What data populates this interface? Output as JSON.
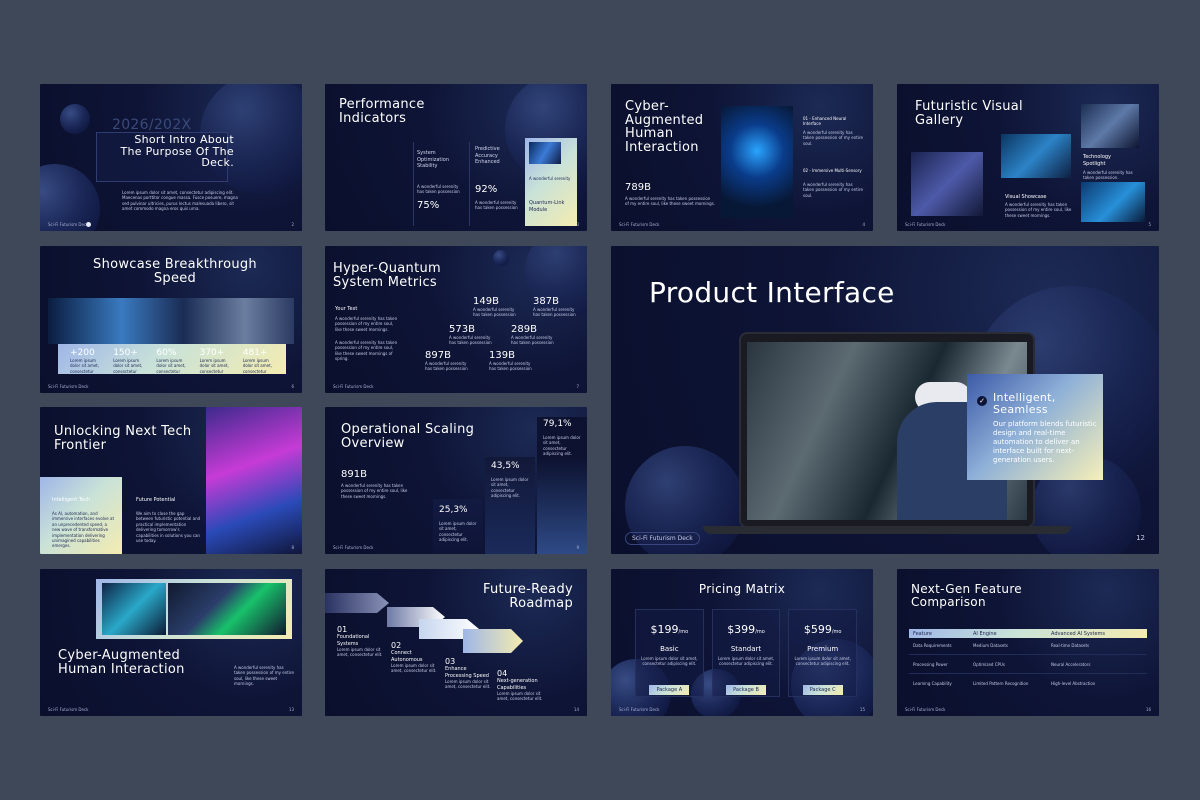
{
  "deck_name": "Sci-Fi Futurism Deck",
  "s1": {
    "year": "2026/202X",
    "title": "Short Intro About The Purpose Of The Deck.",
    "body": "Lorem ipsum dolor sit amet, consectetur adipiscing elit. Maecenas porttitor congue massa. Fusce posuere, magna sed pulvinar ultricies, purus lectus malesuada libero, sit amet commodo magna eros quis urna.",
    "num": "2"
  },
  "s2": {
    "title": "Performance Indicators",
    "c1_label": "System Optimization Stability",
    "c1_desc": "A wonderful serenity has taken possession",
    "c1_val": "75%",
    "c2_label": "Predictive Accuracy Enhanced",
    "c2_desc": "A wonderful serenity has taken possession",
    "c2_val": "92%",
    "c3_desc": "A wonderful serenity",
    "c3_label": "Quantum-Link Module",
    "num": "3"
  },
  "s3": {
    "title": "Cyber-Augmented Human Interaction",
    "stat": "789B",
    "stat_desc": "A wonderful serenity has taken possession of my entire soul, like these sweet mornings.",
    "i1": "01 - Enhanced Neural Interface",
    "i1_desc": "A wonderful serenity has taken possession of my entire soul.",
    "i2": "02 - Immersive Multi-Sensory",
    "i2_desc": "A wonderful serenity has taken possession of my entire soul.",
    "num": "4"
  },
  "s4": {
    "title": "Futuristic Visual Gallery",
    "cap1": "Visual Showcase",
    "cap1_desc": "A wonderful serenity has taken possession of my entire soul, like these sweet mornings.",
    "cap2": "Technology Spotlight",
    "cap2_desc": "A wonderful serenity has taken possession.",
    "num": "5"
  },
  "s5": {
    "title": "Showcase Breakthrough Speed",
    "stats": [
      {
        "v": "+200",
        "d": "Lorem ipsum dolor sit amet, consectetur"
      },
      {
        "v": "150+",
        "d": "Lorem ipsum dolor sit amet, consectetur"
      },
      {
        "v": "60%",
        "d": "Lorem ipsum dolor sit amet, consectetur"
      },
      {
        "v": "370+",
        "d": "Lorem ipsum dolor sit amet, consectetur"
      },
      {
        "v": "481+",
        "d": "Lorem ipsum dolor sit amet, consectetur"
      }
    ],
    "num": "6"
  },
  "s6": {
    "title": "Hyper-Quantum System Metrics",
    "sub": "Your Text",
    "p1": "A wonderful serenity has taken possession of my entire soul, like these sweet mornings.",
    "p2": "A wonderful serenity has taken possession of my entire soul, like these sweet mornings of spring.",
    "m": [
      {
        "v": "149B",
        "d": "A wonderful serenity has taken possession"
      },
      {
        "v": "387B",
        "d": "A wonderful serenity has taken possession"
      },
      {
        "v": "573B",
        "d": "A wonderful serenity has taken possession"
      },
      {
        "v": "289B",
        "d": "A wonderful serenity has taken possession"
      },
      {
        "v": "897B",
        "d": "A wonderful serenity has taken possession"
      },
      {
        "v": "139B",
        "d": "A wonderful serenity has taken possession"
      }
    ],
    "num": "7"
  },
  "s7": {
    "title": "Product Interface",
    "card_title": "Intelligent, Seamless",
    "card_body": "Our platform blends futuristic design and real-time automation to deliver an interface built for next-generation users.",
    "num": "12"
  },
  "s8": {
    "title": "Unlocking Next Tech Frontier",
    "c1": "Intelligent Tech",
    "c1_desc": "As AI, automation, and immersive interfaces evolve at an unprecedented speed, a new wave of transformative implementation delivering unimagined capabilities emerges.",
    "c2": "Future Potential",
    "c2_desc": "We aim to close the gap between futuristic potential and practical implementation delivering tomorrow's capabilities in solutions you can use today.",
    "num": "8"
  },
  "s9": {
    "title": "Operational Scaling Overview",
    "stat": "891B",
    "stat_desc": "A wonderful serenity has taken possession of my entire soul, like these sweet mornings.",
    "b1": "25,3%",
    "b1_desc": "Lorem ipsum dolor sit amet, consectetur adipiscing elit.",
    "b2": "43,5%",
    "b2_desc": "Lorem ipsum dolor sit amet, consectetur adipiscing elit.",
    "b3": "79,1%",
    "b3_desc": "Lorem ipsum dolor sit amet, consectetur adipiscing elit.",
    "num": "9"
  },
  "s10": {
    "title": "Cyber-Augmented Human Interaction",
    "body": "A wonderful serenity has taken possession of my entire soul, like these sweet mornings.",
    "num": "13"
  },
  "s11": {
    "title": "Future-Ready Roadmap",
    "steps": [
      {
        "n": "01",
        "t": "Foundational Systems",
        "d": "Lorem ipsum dolor sit amet, consectetur elit."
      },
      {
        "n": "02",
        "t": "Connect Autonomous",
        "d": "Lorem ipsum dolor sit amet, consectetur elit."
      },
      {
        "n": "03",
        "t": "Enhance Processing Speed",
        "d": "Lorem ipsum dolor sit amet, consectetur elit."
      },
      {
        "n": "04",
        "t": "Next-generation Capabilities",
        "d": "Lorem ipsum dolor sit amet, consectetur elit."
      }
    ],
    "num": "14"
  },
  "s12": {
    "title": "Pricing Matrix",
    "plans": [
      {
        "price": "$199",
        "per": "/mo",
        "name": "Basic",
        "d": "Lorem ipsum dolor sit amet, consectetur adipiscing elit.",
        "btn": "Package A"
      },
      {
        "price": "$399",
        "per": "/mo",
        "name": "Standart",
        "d": "Lorem ipsum dolor sit amet, consectetur adipiscing elit.",
        "btn": "Package B"
      },
      {
        "price": "$599",
        "per": "/mo",
        "name": "Premium",
        "d": "Lorem ipsum dolor sit amet, consectetur adipiscing elit.",
        "btn": "Package C"
      }
    ],
    "num": "15"
  },
  "s13": {
    "title": "Next-Gen Feature Comparison",
    "headers": [
      "Feature",
      "AI Engine",
      "Advanced AI Systems"
    ],
    "rows": [
      [
        "Data Requirements",
        "Medium Datasets",
        "Real-time Datasets"
      ],
      [
        "Processing Power",
        "Optimized CPUs",
        "Neural Accelerators"
      ],
      [
        "Learning Capability",
        "Limited Pattern Recognition",
        "High-level Abstraction"
      ]
    ],
    "num": "16"
  }
}
